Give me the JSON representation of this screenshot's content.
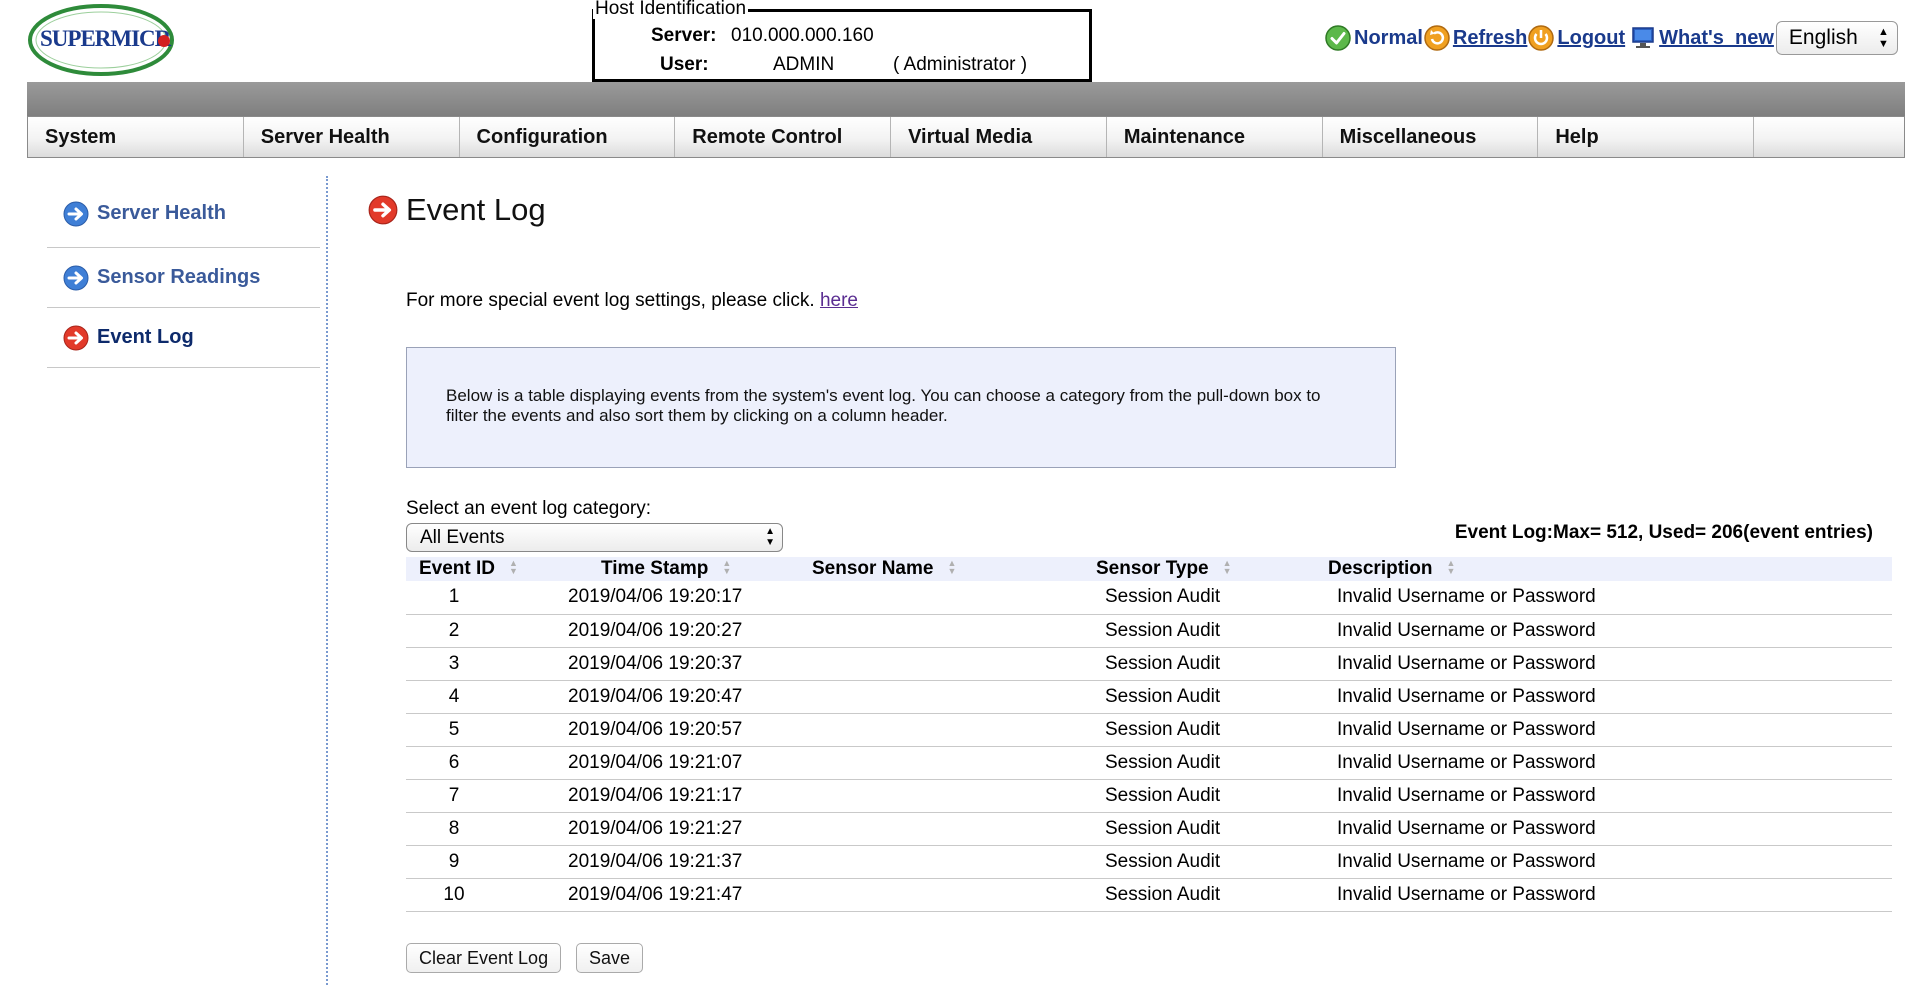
{
  "header": {
    "logo_text": "SUPERMICR",
    "host_identification": {
      "legend": "Host Identification",
      "server_label": "Server:",
      "server_value": "010.000.000.160",
      "user_label": "User:",
      "user_value": "ADMIN",
      "user_role": "( Administrator )"
    },
    "status": {
      "label": "Normal",
      "icon": "green-check-icon",
      "color": "#3a9a2a"
    },
    "refresh_label": "Refresh",
    "logout_label": "Logout",
    "whats_new_label": "What's_new",
    "language": {
      "selected": "English"
    },
    "link_color": "#1a3a8c"
  },
  "main_nav": [
    {
      "label": "System"
    },
    {
      "label": "Server Health"
    },
    {
      "label": "Configuration"
    },
    {
      "label": "Remote Control"
    },
    {
      "label": "Virtual Media"
    },
    {
      "label": "Maintenance"
    },
    {
      "label": "Miscellaneous"
    },
    {
      "label": "Help"
    }
  ],
  "sidebar": {
    "items": [
      {
        "label": "Server Health",
        "icon": "blue-arrow-icon",
        "active": false
      },
      {
        "label": "Sensor Readings",
        "icon": "blue-arrow-icon",
        "active": false
      },
      {
        "label": "Event Log",
        "icon": "red-arrow-icon",
        "active": true
      }
    ]
  },
  "content": {
    "title": "Event Log",
    "special_text": "For more special event log settings, please click.",
    "special_link": "here",
    "info": "Below is a table displaying events from the system's event log. You can choose a category from the pull-down box to filter the events and also sort them by clicking on a column header.",
    "category_label": "Select an event log category:",
    "category_selected": "All Events",
    "log_usage": "Event Log:Max= 512, Used= 206(event entries)",
    "table": {
      "columns": [
        "Event ID",
        "Time Stamp",
        "Sensor Name",
        "Sensor Type",
        "Description"
      ],
      "rows": [
        {
          "id": "1",
          "timestamp": "2019/04/06 19:20:17",
          "sensor_name": "",
          "sensor_type": "Session Audit",
          "description": "Invalid Username or Password"
        },
        {
          "id": "2",
          "timestamp": "2019/04/06 19:20:27",
          "sensor_name": "",
          "sensor_type": "Session Audit",
          "description": "Invalid Username or Password"
        },
        {
          "id": "3",
          "timestamp": "2019/04/06 19:20:37",
          "sensor_name": "",
          "sensor_type": "Session Audit",
          "description": "Invalid Username or Password"
        },
        {
          "id": "4",
          "timestamp": "2019/04/06 19:20:47",
          "sensor_name": "",
          "sensor_type": "Session Audit",
          "description": "Invalid Username or Password"
        },
        {
          "id": "5",
          "timestamp": "2019/04/06 19:20:57",
          "sensor_name": "",
          "sensor_type": "Session Audit",
          "description": "Invalid Username or Password"
        },
        {
          "id": "6",
          "timestamp": "2019/04/06 19:21:07",
          "sensor_name": "",
          "sensor_type": "Session Audit",
          "description": "Invalid Username or Password"
        },
        {
          "id": "7",
          "timestamp": "2019/04/06 19:21:17",
          "sensor_name": "",
          "sensor_type": "Session Audit",
          "description": "Invalid Username or Password"
        },
        {
          "id": "8",
          "timestamp": "2019/04/06 19:21:27",
          "sensor_name": "",
          "sensor_type": "Session Audit",
          "description": "Invalid Username or Password"
        },
        {
          "id": "9",
          "timestamp": "2019/04/06 19:21:37",
          "sensor_name": "",
          "sensor_type": "Session Audit",
          "description": "Invalid Username or Password"
        },
        {
          "id": "10",
          "timestamp": "2019/04/06 19:21:47",
          "sensor_name": "",
          "sensor_type": "Session Audit",
          "description": "Invalid Username or Password"
        }
      ]
    },
    "buttons": {
      "clear": "Clear Event Log",
      "save": "Save"
    }
  }
}
